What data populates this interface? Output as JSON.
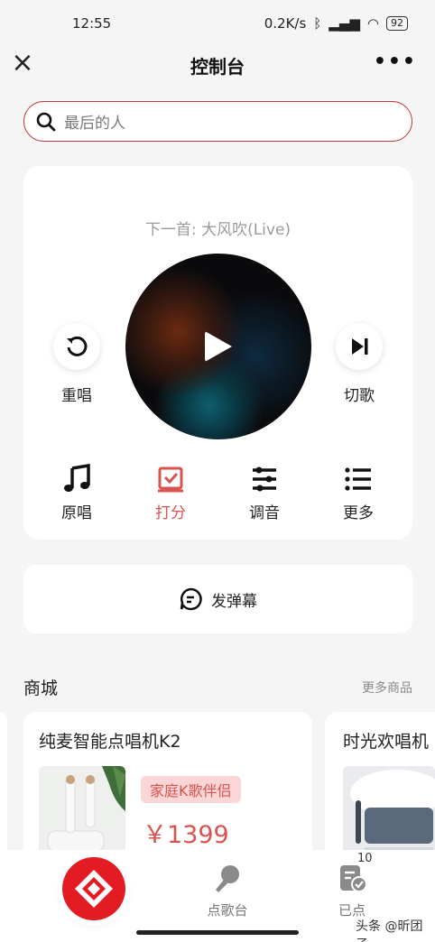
{
  "status_bar": {
    "time": "12:55",
    "speed": "0.2K/s",
    "battery": "92"
  },
  "titlebar": {
    "title": "控制台",
    "close_icon": "close-icon",
    "more_label": "•••"
  },
  "search": {
    "placeholder": "最后的人"
  },
  "player": {
    "next_song": "下一首: 大风吹(Live)",
    "replay_label": "重唱",
    "skip_label": "切歌",
    "tools": [
      {
        "label": "原唱",
        "icon": "music-note-icon",
        "active": false
      },
      {
        "label": "打分",
        "icon": "score-icon",
        "active": true
      },
      {
        "label": "调音",
        "icon": "tuning-icon",
        "active": false
      },
      {
        "label": "更多",
        "icon": "list-icon",
        "active": false
      }
    ]
  },
  "danmu": {
    "label": "发弹幕"
  },
  "shop": {
    "title": "商城",
    "more": "更多商品",
    "products": [
      {
        "name": "纯麦智能点唱机K2",
        "tag": "家庭K歌伴侣",
        "price": "￥1399"
      },
      {
        "name": "时光欢唱机"
      }
    ]
  },
  "tabbar": {
    "tabs": [
      {
        "label": "点歌台"
      },
      {
        "label": "已点"
      }
    ],
    "badge": "10"
  },
  "watermark": "头条 @昕团子",
  "colors": {
    "accent": "#d9534f",
    "brand_red": "#e31b23",
    "background": "#f5f5f5"
  }
}
